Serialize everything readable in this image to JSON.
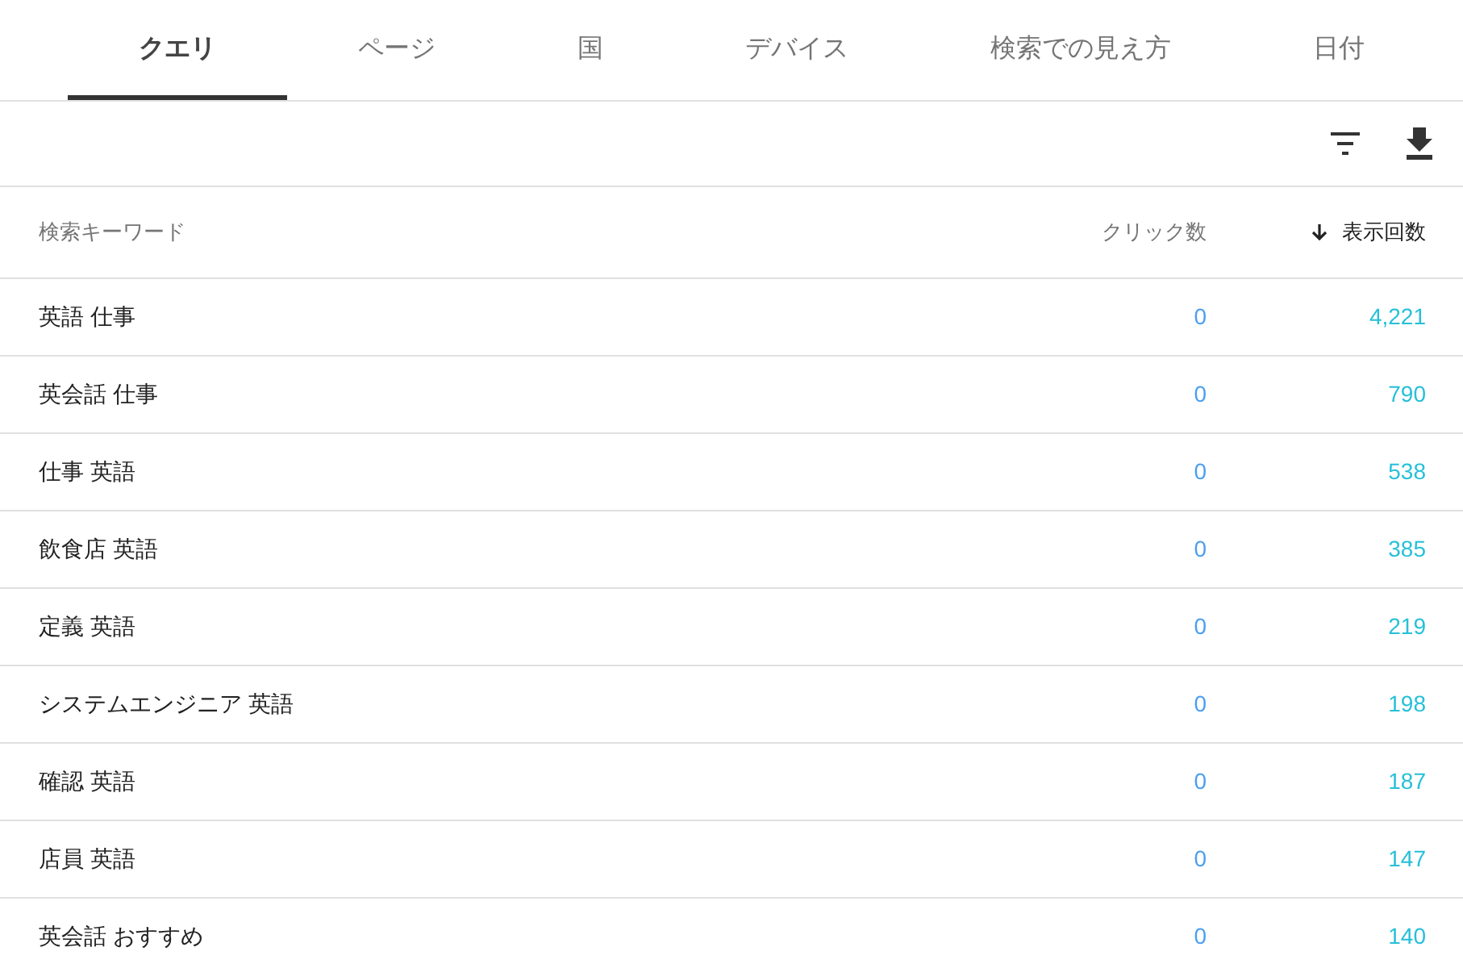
{
  "tabs": [
    {
      "label": "クエリ",
      "selected": true
    },
    {
      "label": "ページ",
      "selected": false
    },
    {
      "label": "国",
      "selected": false
    },
    {
      "label": "デバイス",
      "selected": false
    },
    {
      "label": "検索での見え方",
      "selected": false
    },
    {
      "label": "日付",
      "selected": false
    }
  ],
  "table": {
    "columns": [
      {
        "label": "検索キーワード",
        "sorted": false
      },
      {
        "label": "クリック数",
        "sorted": false
      },
      {
        "label": "表示回数",
        "sorted": true
      }
    ],
    "rows": [
      [
        "英語 仕事",
        "0",
        "4,221"
      ],
      [
        "英会話 仕事",
        "0",
        "790"
      ],
      [
        "仕事 英語",
        "0",
        "538"
      ],
      [
        "飲食店 英語",
        "0",
        "385"
      ],
      [
        "定義 英語",
        "0",
        "219"
      ],
      [
        "システムエンジニア 英語",
        "0",
        "198"
      ],
      [
        "確認 英語",
        "0",
        "187"
      ],
      [
        "店員 英語",
        "0",
        "147"
      ],
      [
        "英会話 おすすめ",
        "0",
        "140"
      ]
    ]
  }
}
